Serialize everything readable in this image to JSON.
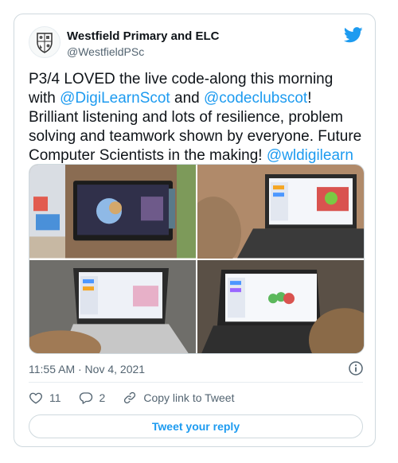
{
  "tweet": {
    "author_name": "Westfield Primary and ELC",
    "author_handle": "@WestfieldPSc",
    "text_segments": [
      {
        "text": "P3/4 LOVED the live code-along this morning with ",
        "link": false
      },
      {
        "text": "@DigiLearnScot",
        "link": true
      },
      {
        "text": " and ",
        "link": false
      },
      {
        "text": "@codeclubscot",
        "link": true
      },
      {
        "text": "! Brilliant listening and lots of resilience, problem solving and teamwork shown by everyone. Future Computer Scientists in the making! ",
        "link": false
      },
      {
        "text": "@wldigilearn",
        "link": true
      }
    ],
    "timestamp": "11:55 AM · Nov 4, 2021",
    "likes": "11",
    "replies": "2",
    "copy_link_label": "Copy link to Tweet",
    "reply_button_label": "Tweet your reply"
  },
  "icons": {
    "brand": "twitter-bird-icon",
    "info": "info-icon",
    "like": "heart-icon",
    "reply": "speech-bubble-icon",
    "copy": "link-icon"
  },
  "colors": {
    "accent": "#1d9bf0",
    "text": "#0f1419",
    "muted": "#536471",
    "border": "#cfd9de"
  }
}
